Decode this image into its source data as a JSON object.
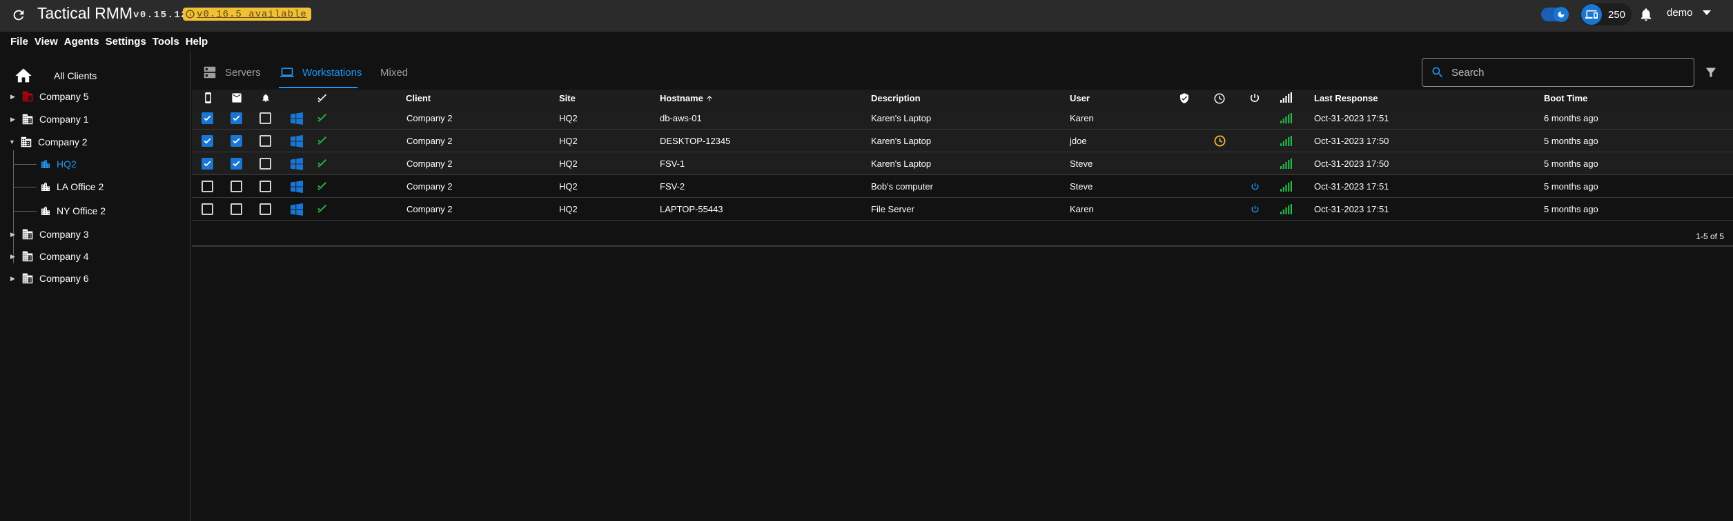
{
  "header": {
    "title": "Tactical RMM",
    "version": "v0.15.12",
    "update_badge": "v0.16.5 available",
    "agent_count": "250",
    "username": "demo"
  },
  "menu": [
    "File",
    "View",
    "Agents",
    "Settings",
    "Tools",
    "Help"
  ],
  "sidebar": {
    "all_clients": "All Clients",
    "clients": [
      {
        "name": "Company 5",
        "expanded": false,
        "accent": true
      },
      {
        "name": "Company 1",
        "expanded": false
      },
      {
        "name": "Company 2",
        "expanded": true,
        "sites": [
          "HQ2",
          "LA Office 2",
          "NY Office 2"
        ],
        "selected_site": "HQ2"
      },
      {
        "name": "Company 3",
        "expanded": false
      },
      {
        "name": "Company 4",
        "expanded": false
      },
      {
        "name": "Company 6",
        "expanded": false
      }
    ]
  },
  "tabs": [
    {
      "label": "Servers",
      "icon": "server-icon",
      "active": false
    },
    {
      "label": "Workstations",
      "icon": "laptop-icon",
      "active": true
    },
    {
      "label": "Mixed",
      "icon": "",
      "active": false
    }
  ],
  "search": {
    "placeholder": "Search",
    "value": ""
  },
  "table": {
    "headers": {
      "client": "Client",
      "site": "Site",
      "hostname": "Hostname",
      "description": "Description",
      "user": "User",
      "last_response": "Last Response",
      "boot_time": "Boot Time"
    },
    "header_icons": [
      "mobile-icon",
      "mail-icon",
      "bell-icon",
      "checks-icon",
      "shield-icon",
      "clock-icon",
      "power-icon",
      "signal-icon"
    ],
    "rows": [
      {
        "mobile": true,
        "mail": true,
        "alert": false,
        "client": "Company 2",
        "site": "HQ2",
        "hostname": "db-aws-01",
        "description": "Karen's Laptop",
        "user": "Karen",
        "pending": false,
        "reboot": false,
        "last_response": "Oct-31-2023 17:51",
        "boot_time": "6 months ago"
      },
      {
        "mobile": true,
        "mail": true,
        "alert": false,
        "client": "Company 2",
        "site": "HQ2",
        "hostname": "DESKTOP-12345",
        "description": "Karen's Laptop",
        "user": "jdoe",
        "pending": true,
        "reboot": false,
        "last_response": "Oct-31-2023 17:50",
        "boot_time": "5 months ago"
      },
      {
        "mobile": true,
        "mail": true,
        "alert": false,
        "client": "Company 2",
        "site": "HQ2",
        "hostname": "FSV-1",
        "description": "Karen's Laptop",
        "user": "Steve",
        "pending": false,
        "reboot": false,
        "last_response": "Oct-31-2023 17:50",
        "boot_time": "5 months ago"
      },
      {
        "mobile": false,
        "mail": false,
        "alert": false,
        "client": "Company 2",
        "site": "HQ2",
        "hostname": "FSV-2",
        "description": "Bob's computer",
        "user": "Steve",
        "pending": false,
        "reboot": true,
        "last_response": "Oct-31-2023 17:51",
        "boot_time": "5 months ago"
      },
      {
        "mobile": false,
        "mail": false,
        "alert": false,
        "client": "Company 2",
        "site": "HQ2",
        "hostname": "LAPTOP-55443",
        "description": "File Server",
        "user": "Karen",
        "pending": false,
        "reboot": true,
        "last_response": "Oct-31-2023 17:51",
        "boot_time": "5 months ago"
      }
    ],
    "pagination": "1-5 of 5"
  },
  "colors": {
    "accent": "#2196f3",
    "checkbox": "#1976d2",
    "ok_green": "#21ba45",
    "pending_orange": "#f2c037",
    "client_red": "#c10015"
  }
}
